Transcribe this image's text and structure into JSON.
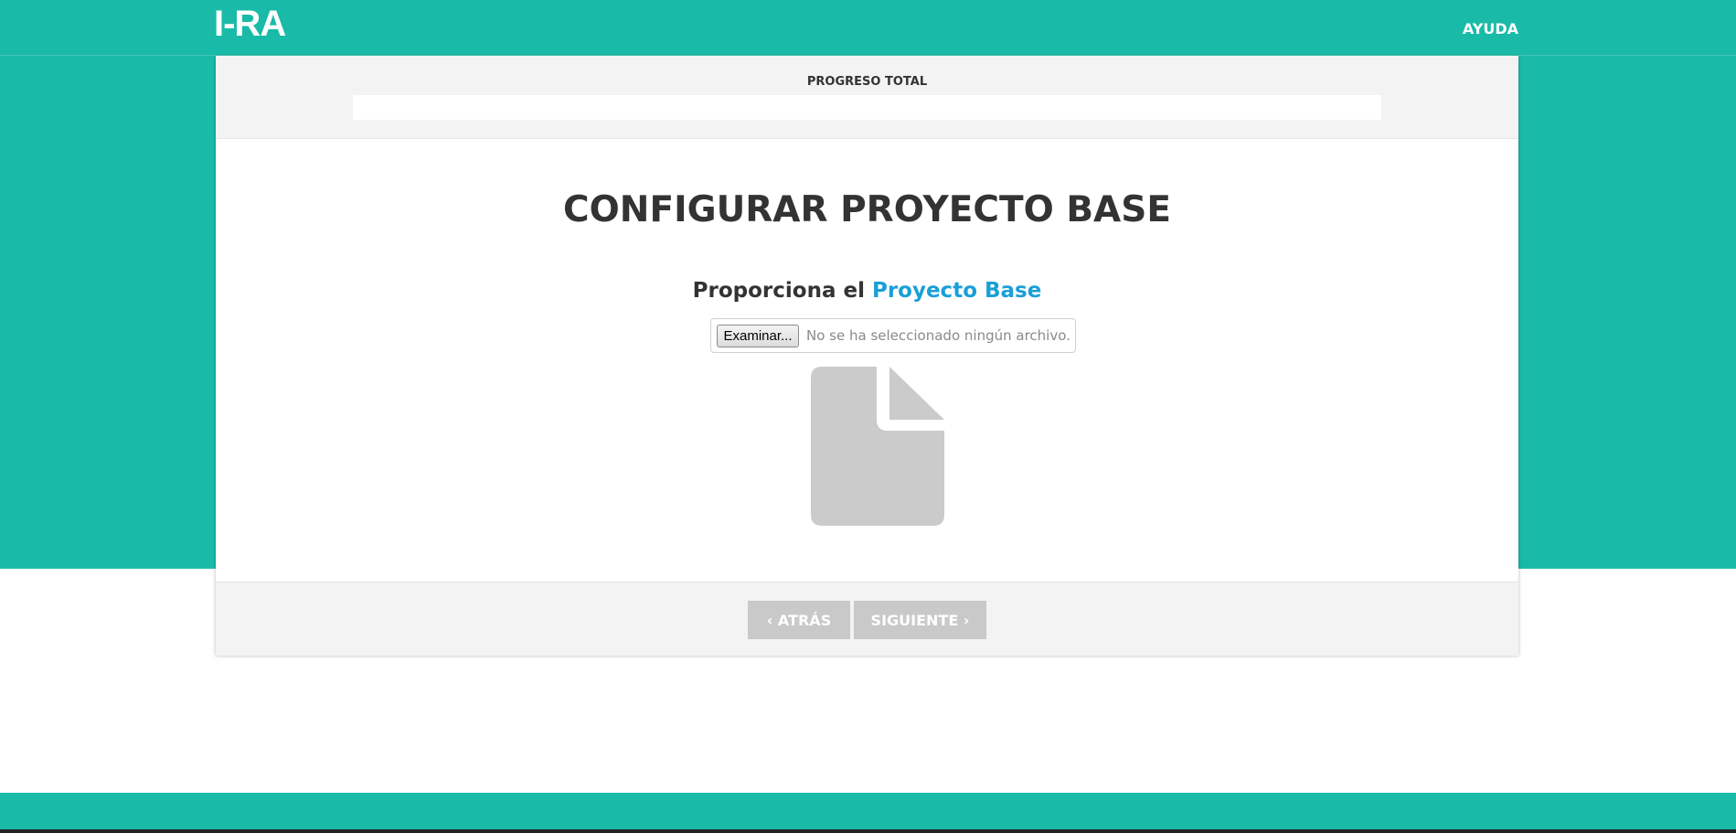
{
  "header": {
    "logo": "I-RA",
    "help_link": "AYUDA"
  },
  "progress": {
    "label": "PROGRESO TOTAL",
    "value_percent": 0
  },
  "main": {
    "title": "CONFIGURAR PROYECTO BASE",
    "subtitle_prefix": "Proporciona el",
    "subtitle_highlight": "Proyecto Base",
    "file_input": {
      "button_label": "Examinar...",
      "status": "No se ha seleccionado ningún archivo."
    },
    "file_icon": "file-icon"
  },
  "footer": {
    "back_label": "‹ ATRÁS",
    "next_label": "SIGUIENTE ›"
  },
  "colors": {
    "brand": "#1abaa8",
    "accent": "#1a9fd8",
    "button_disabled": "#c9c9c9",
    "icon_gray": "#cbcbcb"
  }
}
